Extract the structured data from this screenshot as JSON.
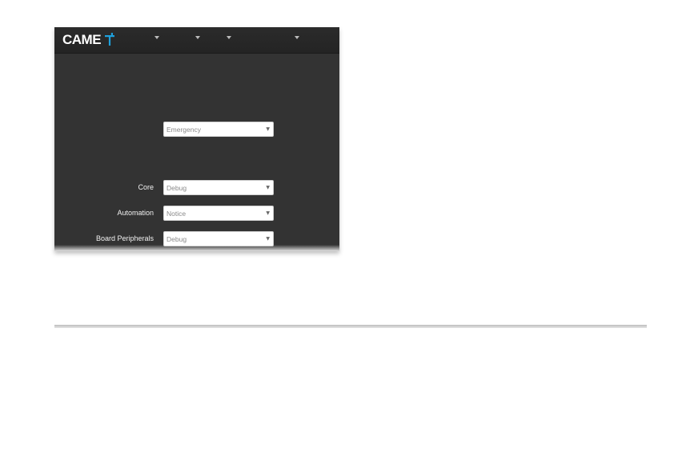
{
  "brand": {
    "name": "CAME",
    "logo_icon": "came-t-logo-icon",
    "logo_color": "#1ea0dc"
  },
  "navbar": {
    "menus": [
      {
        "icon": "caret-down-icon"
      },
      {
        "icon": "caret-down-icon"
      },
      {
        "icon": "caret-down-icon"
      },
      {
        "icon": "caret-down-icon"
      }
    ]
  },
  "form": {
    "general": {
      "label": "",
      "value": "Emergency"
    },
    "rows": [
      {
        "label": "Core",
        "value": "Debug"
      },
      {
        "label": "Automation",
        "value": "Notice"
      },
      {
        "label": "Board Peripherals",
        "value": "Debug"
      }
    ],
    "select_arrow": "▼"
  },
  "colors": {
    "panel_bg": "#333333",
    "navbar_bg": "#262626",
    "label_text": "#f2f2f2",
    "select_text": "#8a8a8a"
  }
}
